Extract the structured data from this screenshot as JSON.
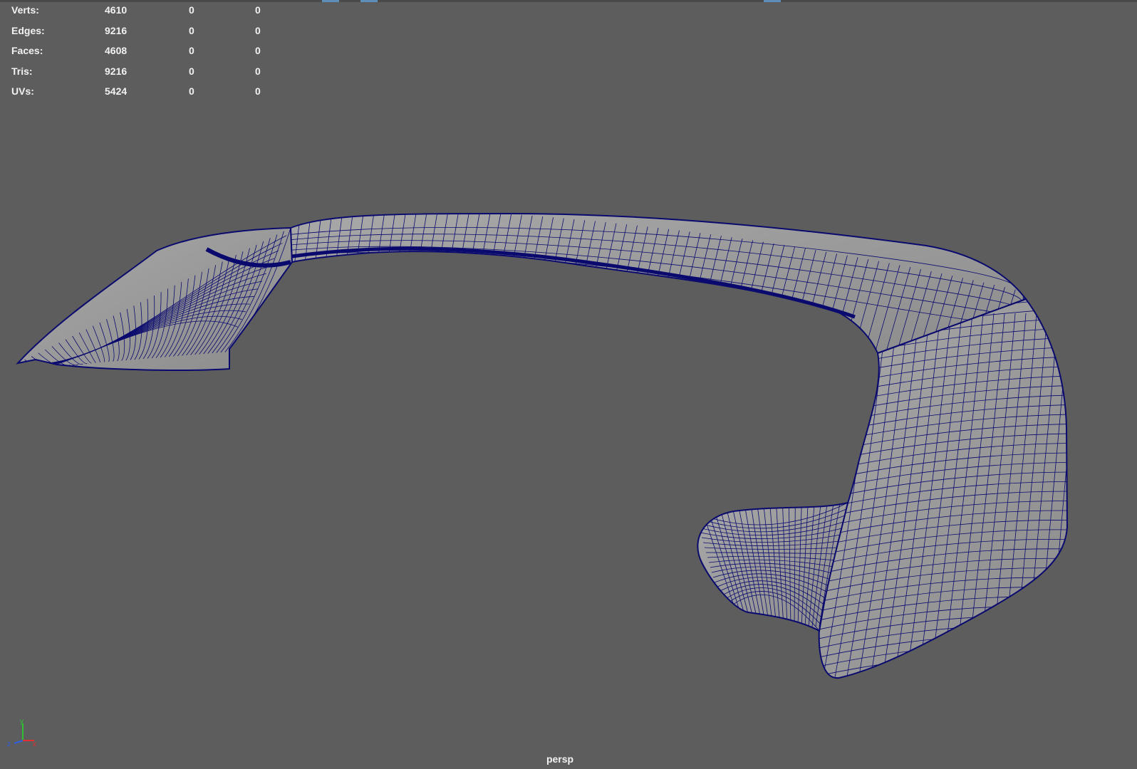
{
  "hud": {
    "rows": [
      {
        "label": "Verts:",
        "total": "4610",
        "selected": "0",
        "third": "0"
      },
      {
        "label": "Edges:",
        "total": "9216",
        "selected": "0",
        "third": "0"
      },
      {
        "label": "Faces:",
        "total": "4608",
        "selected": "0",
        "third": "0"
      },
      {
        "label": "Tris:",
        "total": "9216",
        "selected": "0",
        "third": "0"
      },
      {
        "label": "UVs:",
        "total": "5424",
        "selected": "0",
        "third": "0"
      }
    ]
  },
  "axis": {
    "x": "x",
    "y": "y",
    "z": "z"
  },
  "camera": "persp",
  "colors": {
    "background": "#5d5d5d",
    "wireframe": "#0a0a6e",
    "surface": "#9a9a9a",
    "surface_shadow": "#7d7d7d",
    "axis_x": "#e03030",
    "axis_y": "#30c030",
    "axis_z": "#3060e0"
  }
}
